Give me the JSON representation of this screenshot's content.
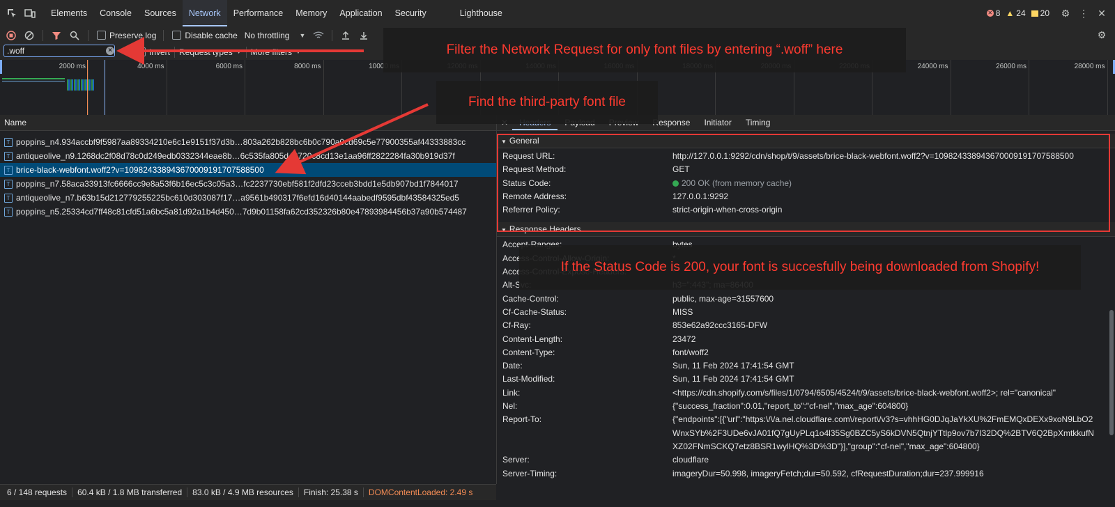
{
  "tabs": [
    "Elements",
    "Console",
    "Sources",
    "Network",
    "Performance",
    "Memory",
    "Application",
    "Security",
    "Lighthouse"
  ],
  "badges": {
    "errors": "8",
    "warnings": "24",
    "issues": "20"
  },
  "toolbar": {
    "preserve_log": "Preserve log",
    "disable_cache": "Disable cache",
    "throttling": "No throttling"
  },
  "filter": {
    "value": ".woff",
    "invert": "Invert",
    "request_types": "Request types",
    "more_filters": "More filters"
  },
  "timeline": {
    "ticks": [
      "2000 ms",
      "4000 ms",
      "6000 ms",
      "8000 ms",
      "10000 ms",
      "12000 ms",
      "14000 ms",
      "16000 ms",
      "18000 ms",
      "20000 ms",
      "22000 ms",
      "24000 ms",
      "26000 ms",
      "28000 ms"
    ]
  },
  "list": {
    "header": "Name",
    "rows": [
      "poppins_n4.934accbf9f5987aa89334210e6c1e9151f37d3b…803a262b828bc6b0c790a0cd69c5e77900355af44333883cc",
      "antiqueolive_n9.1268dc2f08d78c0d249edb0332344eae8b…6c535fa805d43720c8cd13e1aa96ff2822284fa30b919d37f",
      "brice-black-webfont.woff2?v=109824338943670009191707588500",
      "poppins_n7.58aca33913fc6666cc9e8a53f6b16ec5c3c05a3…fc2237730ebf581f2dfd23cceb3bdd1e5db907bd1f7844017",
      "antiqueolive_n7.b63b15d212779255225bc610d303087f17…a9561b490317f6efd16d40144aabedf9595dbf43584325ed5",
      "poppins_n5.25334cd7ff48c81cfd51a6bc5a81d92a1b4d450…7d9b01158fa62cd352326b80e47893984456b37a90b574487"
    ],
    "selected_index": 2
  },
  "status": {
    "requests": "6 / 148 requests",
    "transferred": "60.4 kB / 1.8 MB transferred",
    "resources": "83.0 kB / 4.9 MB resources",
    "finish": "Finish: 25.38 s",
    "dom": "DOMContentLoaded: 2.49 s"
  },
  "detail": {
    "tabs": [
      "Headers",
      "Payload",
      "Preview",
      "Response",
      "Initiator",
      "Timing"
    ],
    "general_title": "General",
    "general": [
      {
        "k": "Request URL:",
        "v": "http://127.0.0.1:9292/cdn/shop/t/9/assets/brice-black-webfont.woff2?v=109824338943670009191707588500"
      },
      {
        "k": "Request Method:",
        "v": "GET"
      },
      {
        "k": "Status Code:",
        "v": "200 OK (from memory cache)"
      },
      {
        "k": "Remote Address:",
        "v": "127.0.0.1:9292"
      },
      {
        "k": "Referrer Policy:",
        "v": "strict-origin-when-cross-origin"
      }
    ],
    "response_title": "Response Headers",
    "response": [
      {
        "k": "Accept-Ranges:",
        "v": "bytes"
      },
      {
        "k": "Access-Control-Allow-Origin:",
        "v": "*"
      },
      {
        "k": "Access-Control-Expose-Headers:",
        "v": "*"
      },
      {
        "k": "Alt-Svc:",
        "v": "h3=\":443\"; ma=86400"
      },
      {
        "k": "Cache-Control:",
        "v": "public, max-age=31557600"
      },
      {
        "k": "Cf-Cache-Status:",
        "v": "MISS"
      },
      {
        "k": "Cf-Ray:",
        "v": "853e62a92ccc3165-DFW"
      },
      {
        "k": "Content-Length:",
        "v": "23472"
      },
      {
        "k": "Content-Type:",
        "v": "font/woff2"
      },
      {
        "k": "Date:",
        "v": "Sun, 11 Feb 2024 17:41:54 GMT"
      },
      {
        "k": "Last-Modified:",
        "v": "Sun, 11 Feb 2024 17:41:54 GMT"
      },
      {
        "k": "Link:",
        "v": "<https://cdn.shopify.com/s/files/1/0794/6505/4524/t/9/assets/brice-black-webfont.woff2>; rel=\"canonical\""
      },
      {
        "k": "Nel:",
        "v": "{\"success_fraction\":0.01,\"report_to\":\"cf-nel\",\"max_age\":604800}"
      },
      {
        "k": "Report-To:",
        "v": "{\"endpoints\":[{\"url\":\"https:\\/\\/a.nel.cloudflare.com\\/report\\/v3?s=vhhHG0DJqJaYkXU%2FmEMQxDEXx9xoN9LbO2WnxSYb%2F3UDe6vJA01fQ7gUyPLq1o4l35Sg0BZC5yS6kDVN5QtnjYTtlp9ov7b7I32DQ%2BTV6Q2BpXmtkkufNXZ02FNmSCKQ7etz8BSR1wylHQ%3D%3D\"}],\"group\":\"cf-nel\",\"max_age\":604800}"
      },
      {
        "k": "Server:",
        "v": "cloudflare"
      },
      {
        "k": "Server-Timing:",
        "v": "imageryDur=50.998, imageryFetch;dur=50.592, cfRequestDuration;dur=237.999916"
      }
    ]
  },
  "annotations": {
    "filter_note": "Filter the Network Request for only font files by entering “.woff” here",
    "find_note": "Find the third-party font file",
    "status_note": "If the Status Code is 200, your font is succesfully being downloaded from Shopify!"
  },
  "colors": {
    "accent": "#a8c7fa",
    "annotation": "#ff3b30",
    "selected_row": "#004a77",
    "dom_content_loaded": "#f28b54"
  }
}
